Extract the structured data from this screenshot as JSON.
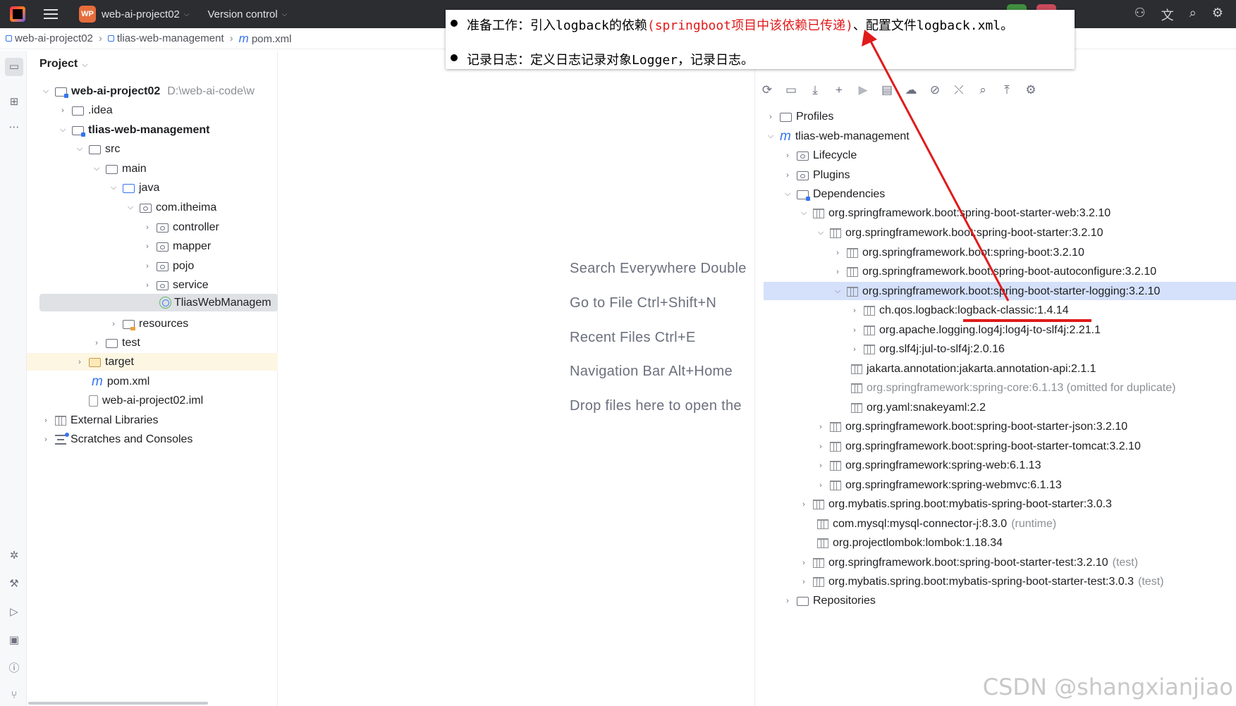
{
  "titlebar": {
    "project_badge": "WP",
    "project_name": "web-ai-project02",
    "vcs_label": "Version control"
  },
  "breadcrumb": {
    "items": [
      "web-ai-project02",
      "tlias-web-management",
      "pom.xml"
    ]
  },
  "project_panel": {
    "title": "Project",
    "root_name": "web-ai-project02",
    "root_path": "D:\\web-ai-code\\w",
    "nodes": {
      "idea": ".idea",
      "module": "tlias-web-management",
      "src": "src",
      "main": "main",
      "java": "java",
      "pkg": "com.itheima",
      "controller": "controller",
      "mapper": "mapper",
      "pojo": "pojo",
      "service": "service",
      "app_class": "TliasWebManagem",
      "resources": "resources",
      "test": "test",
      "target": "target",
      "pom": "pom.xml",
      "iml": "web-ai-project02.iml",
      "ext_libs": "External Libraries",
      "scratches": "Scratches and Consoles"
    }
  },
  "editor_hints": [
    "Search Everywhere Double",
    "Go to File Ctrl+Shift+N",
    "Recent Files Ctrl+E",
    "Navigation Bar Alt+Home",
    "Drop files here to open the"
  ],
  "maven": {
    "profiles": "Profiles",
    "module": "tlias-web-management",
    "lifecycle": "Lifecycle",
    "plugins": "Plugins",
    "dependencies": "Dependencies",
    "deps": [
      {
        "label": "org.springframework.boot:spring-boot-starter-web:3.2.10"
      },
      {
        "label": "org.springframework.boot:spring-boot-starter:3.2.10"
      },
      {
        "label": "org.springframework.boot:spring-boot:3.2.10"
      },
      {
        "label": "org.springframework.boot:spring-boot-autoconfigure:3.2.10"
      },
      {
        "label": "org.springframework.boot:spring-boot-starter-logging:3.2.10"
      },
      {
        "label": "ch.qos.logback:logback-classic:1.4.14"
      },
      {
        "label": "org.apache.logging.log4j:log4j-to-slf4j:2.21.1"
      },
      {
        "label": "org.slf4j:jul-to-slf4j:2.0.16"
      },
      {
        "label": "jakarta.annotation:jakarta.annotation-api:2.1.1"
      },
      {
        "label": "org.springframework:spring-core:6.1.13 (omitted for duplicate)"
      },
      {
        "label": "org.yaml:snakeyaml:2.2"
      },
      {
        "label": "org.springframework.boot:spring-boot-starter-json:3.2.10"
      },
      {
        "label": "org.springframework.boot:spring-boot-starter-tomcat:3.2.10"
      },
      {
        "label": "org.springframework:spring-web:6.1.13"
      },
      {
        "label": "org.springframework:spring-webmvc:6.1.13"
      },
      {
        "label": "org.mybatis.spring.boot:mybatis-spring-boot-starter:3.0.3"
      },
      {
        "label": "com.mysql:mysql-connector-j:8.3.0",
        "scope": "(runtime)"
      },
      {
        "label": "org.projectlombok:lombok:1.18.34"
      },
      {
        "label": "org.springframework.boot:spring-boot-starter-test:3.2.10",
        "scope": "(test)"
      },
      {
        "label": "org.mybatis.spring.boot:mybatis-spring-boot-starter-test:3.0.3",
        "scope": "(test)"
      }
    ],
    "repositories": "Repositories"
  },
  "annotation": {
    "line1_a": "准备工作：引入logback的依赖",
    "line1_red": "(springboot项目中该依赖已传递)",
    "line1_b": "、配置文件logback.xml。",
    "line2": "记录日志：定义日志记录对象Logger，记录日志。"
  },
  "watermark": "CSDN @shangxianjiao",
  "colors": {
    "accent": "#3574f0",
    "annotation_red": "#e01b1b",
    "titlebar_bg": "#2b2d30",
    "selection": "#d5e1fb"
  }
}
